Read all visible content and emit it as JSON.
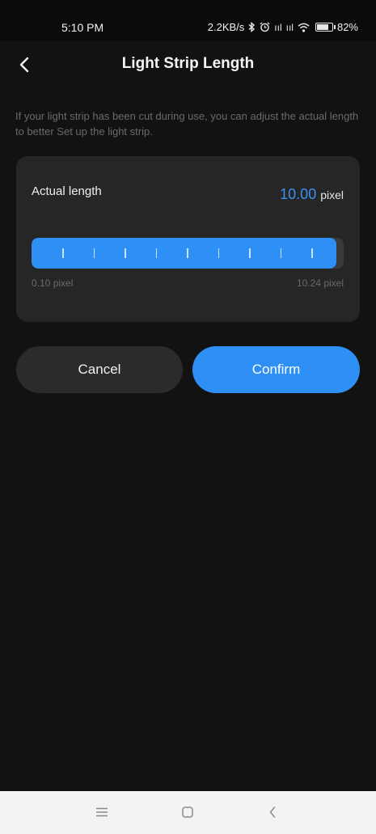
{
  "status_bar": {
    "time": "5:10 PM",
    "network_speed": "2.2KB/s",
    "signal_1": "ııl",
    "signal_2": "ııl",
    "battery": "82%",
    "icons": [
      "bluetooth-icon",
      "alarm-icon",
      "signal-icon",
      "signal-icon",
      "wifi-icon",
      "battery-icon"
    ]
  },
  "header": {
    "back_icon": "chevron-left-icon",
    "title": "Light Strip Length"
  },
  "description": "If your light strip has been cut during use, you can adjust the actual length to better Set up the light strip.",
  "length_card": {
    "label": "Actual length",
    "value": "10.00",
    "unit": "pixel",
    "slider": {
      "min": 0.1,
      "max": 10.24,
      "current": 10.0,
      "tick_count": 9
    },
    "min_label": "0.10 pixel",
    "max_label": "10.24 pixel"
  },
  "actions": {
    "cancel_label": "Cancel",
    "confirm_label": "Confirm"
  },
  "nav_bar": {
    "icons": [
      "menu-icon",
      "home-icon",
      "back-icon"
    ]
  },
  "colors": {
    "accent": "#2e8ff5",
    "value_text": "#3d8ff2",
    "background": "#121212",
    "card": "#262626",
    "secondary_button": "#2b2b2b"
  }
}
